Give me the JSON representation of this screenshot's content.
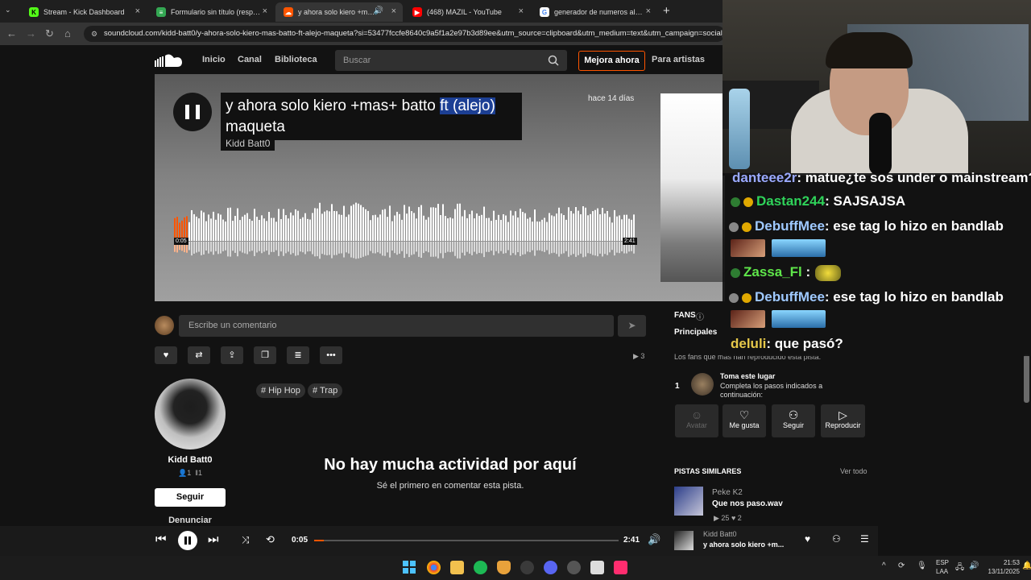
{
  "browser": {
    "tabs": [
      {
        "title": "Stream - Kick Dashboard",
        "color": "#53fc18",
        "glyph": "K"
      },
      {
        "title": "Formulario sin título (respuestas)",
        "color": "#34a853",
        "glyph": "≡"
      },
      {
        "title": "y ahora solo kiero +mas+ batto",
        "color": "#ff5500",
        "glyph": "☁"
      },
      {
        "title": "(468) MAZIL - YouTube",
        "color": "#ff0000",
        "glyph": "▶"
      },
      {
        "title": "generador de numeros aleatorios",
        "color": "#4285f4",
        "glyph": "G"
      }
    ],
    "new_tab": "+",
    "url": "soundcloud.com/kidd-batt0/y-ahora-solo-kiero-mas-batto-ft-alejo-maqueta?si=53477fccfe8640c9a5f1a2e97b3d89ee&utm_source=clipboard&utm_medium=text&utm_campaign=social_"
  },
  "header": {
    "nav": [
      "Inicio",
      "Canal",
      "Biblioteca"
    ],
    "search_placeholder": "Buscar",
    "upgrade": "Mejora ahora",
    "for_artists": "Para artistas"
  },
  "track": {
    "title_a": "y ahora solo kiero +mas+ batto ",
    "title_sel": "ft (alejo)",
    "title_b": " maqueta",
    "artist": "Kidd Batt0",
    "posted": "hace 14 días",
    "time_current": "0:05",
    "time_total": "2:41",
    "progress": 0.031
  },
  "comment": {
    "placeholder": "Escribe un comentario"
  },
  "plays_count": "3",
  "artist_panel": {
    "name": "Kidd Batt0",
    "followers": "1",
    "tracks": "1",
    "follow": "Seguir",
    "report": "Denunciar"
  },
  "tags": [
    "# Hip Hop",
    "# Trap"
  ],
  "empty": {
    "title": "No hay mucha actividad por aquí",
    "subtitle": "Sé el primero en comentar esta pista."
  },
  "sidebar": {
    "fans_title": "FANS",
    "fans_tab": "Principales",
    "fans_desc": "Los fans que más han reproducido esta pista.",
    "rank": "1",
    "place_title": "Toma este lugar",
    "place_desc": "Completa los pasos indicados a continuación:",
    "steps": [
      "Avatar",
      "Me gusta",
      "Seguir",
      "Reproducir"
    ],
    "similar_title": "PISTAS SIMILARES",
    "see_all": "Ver todo",
    "similar": {
      "artist": "Peke K2",
      "title": "Que nos paso.wav",
      "plays": "25",
      "likes": "2"
    }
  },
  "chat": [
    {
      "user": "danteee2r",
      "text": ": matue¿te sos under o mainstream?",
      "color": "#9aa9ff"
    },
    {
      "user": "Dastan244",
      "text": ": SAJSAJSA",
      "color": "#2fd35a"
    },
    {
      "user": "DebuffMee",
      "text": ": ese tag lo hizo en bandlab",
      "color": "#9fc9ff"
    },
    {
      "user": "Zassa_Fl",
      "text": " :",
      "color": "#5fe64a"
    },
    {
      "user": "DebuffMee",
      "text": ": ese tag lo hizo en bandlab",
      "color": "#9fc9ff"
    },
    {
      "user": "deluli",
      "text": ": que pasó?",
      "color": "#e6c84a"
    }
  ],
  "player": {
    "current": "0:05",
    "total": "2:41",
    "artist": "Kidd Batt0",
    "title": "y ahora solo kiero +m..."
  },
  "taskbar": {
    "lang": "ESP",
    "region": "LAA",
    "time": "21:53",
    "date": "13/11/2025"
  }
}
